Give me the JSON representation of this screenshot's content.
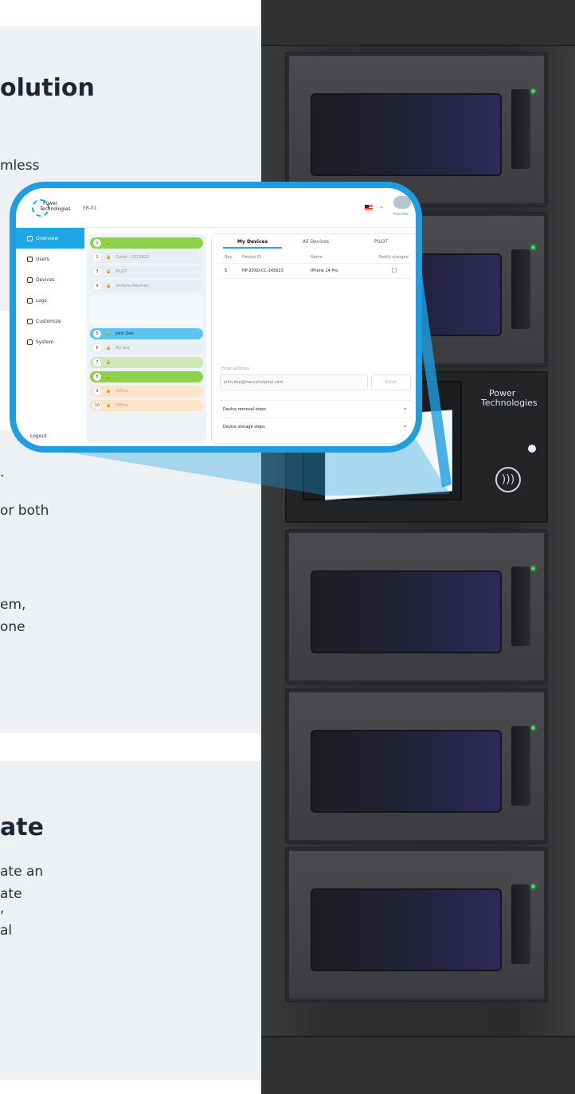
{
  "left_cards": [
    {
      "heading": "olution",
      "body": [
        "mless"
      ]
    },
    {
      "heading": "",
      "body": [
        ".",
        "or both",
        "",
        "em,",
        "one"
      ]
    },
    {
      "heading": "ate",
      "body": [
        "ate an",
        "ate",
        ",",
        "al"
      ]
    }
  ],
  "kiosk": {
    "logo_line1": "Power",
    "logo_line2": "Technologies"
  },
  "app": {
    "logo_line1": "Power",
    "logo_line2": "Technologies",
    "station": "ER-01",
    "help_label": "PowerBot",
    "sidebar": [
      "Overview",
      "Users",
      "Devices",
      "Logs",
      "Customize",
      "System"
    ],
    "logout": "Logout",
    "bays": [
      {
        "num": "1",
        "label": ""
      },
      {
        "num": "2",
        "label": "Guest - 0115822"
      },
      {
        "num": "3",
        "label": "PILOT"
      },
      {
        "num": "4",
        "label": "Victoria Neuman"
      },
      {
        "num": "5",
        "label": "John Doe"
      },
      {
        "num": "6",
        "label": "My bay"
      },
      {
        "num": "7",
        "label": ""
      },
      {
        "num": "8",
        "label": ""
      },
      {
        "num": "9",
        "label": "Offline"
      },
      {
        "num": "10",
        "label": "Offline"
      }
    ],
    "tabs": [
      "My Devices",
      "All Devices",
      "PILOT"
    ],
    "columns": [
      "Bay",
      "Device ID",
      "Name",
      "Notify charged"
    ],
    "rows": [
      {
        "bay": "5",
        "device_id": "HP-20XD-CC-145623",
        "name": "iPhone 14 Pro"
      }
    ],
    "email_label": "Email address",
    "email_placeholder": "john.doe@mercyhospital.com",
    "save_label": "Save",
    "accordion": [
      "Device removal steps",
      "Device storage steps"
    ]
  }
}
